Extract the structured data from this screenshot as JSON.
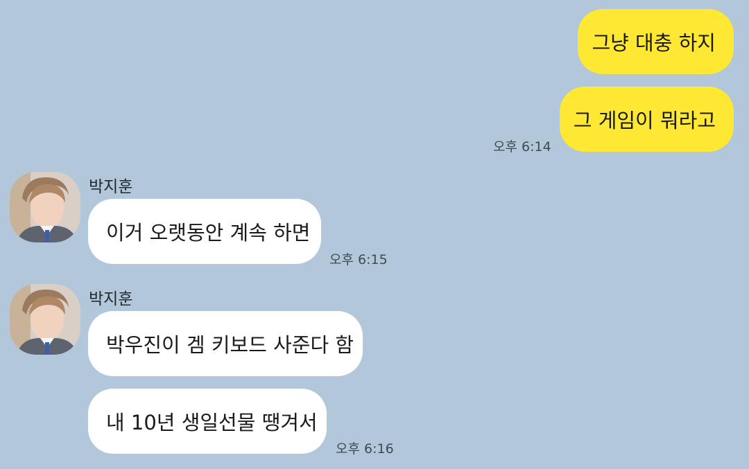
{
  "chat": {
    "background": "#b2c7d9",
    "my_bubble_color": "#fee833",
    "their_bubble_color": "#ffffff",
    "messages": [
      {
        "from": "me",
        "text": "그냥 대충 하지"
      },
      {
        "from": "me",
        "text": "그 게임이 뭐라고",
        "time": "오후 6:14"
      },
      {
        "from": "other",
        "sender": "박지훈",
        "text": "이거 오랫동안 계속 하면",
        "time": "오후 6:15"
      },
      {
        "from": "other",
        "sender": "박지훈",
        "text": "박우진이 겜 키보드 사준다 함"
      },
      {
        "from": "other",
        "text": "내 10년 생일선물 땡겨서",
        "time": "오후 6:16"
      }
    ]
  }
}
